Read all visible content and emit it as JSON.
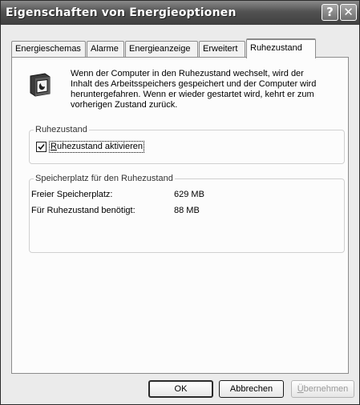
{
  "window": {
    "title": "Eigenschaften von Energieoptionen",
    "help_glyph": "?",
    "close_glyph": "✕"
  },
  "tabs": [
    {
      "label": "Energieschemas",
      "active": false
    },
    {
      "label": "Alarme",
      "active": false
    },
    {
      "label": "Energieanzeige",
      "active": false
    },
    {
      "label": "Erweitert",
      "active": false
    },
    {
      "label": "Ruhezustand",
      "active": true
    }
  ],
  "info": {
    "icon": "computer-hibernate-icon",
    "lines": [
      "Wenn der Computer in den Ruhezustand wechselt, wird der",
      "Inhalt des Arbeitsspeichers gespeichert und der Computer wird",
      "heruntergefahren. Wenn er wieder gestartet wird, kehrt er zum",
      "vorherigen Zustand zurück."
    ]
  },
  "hibernate_group": {
    "title": "Ruhezustand",
    "checkbox_label_first": "R",
    "checkbox_label_rest": "uhezustand aktivieren",
    "checked": true
  },
  "storage_group": {
    "title": "Speicherplatz für den Ruhezustand",
    "rows": [
      {
        "label": "Freier Speicherplatz:",
        "value": "629 MB"
      },
      {
        "label": "Für Ruhezustand benötigt:",
        "value": "88 MB"
      }
    ]
  },
  "buttons": {
    "ok": "OK",
    "cancel": "Abbrechen",
    "apply_first": "Ü",
    "apply_rest": "bernehmen"
  }
}
